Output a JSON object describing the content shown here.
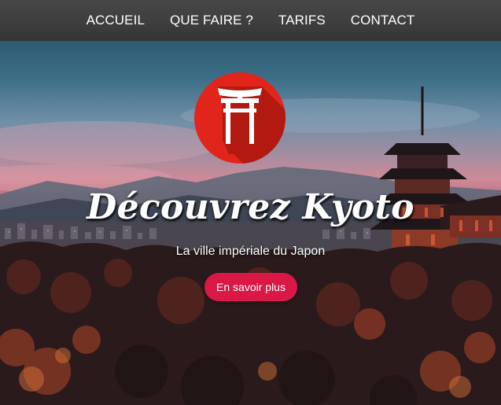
{
  "nav": {
    "items": [
      {
        "label": "ACCUEIL"
      },
      {
        "label": "QUE FAIRE ?"
      },
      {
        "label": "TARIFS"
      },
      {
        "label": "CONTACT"
      }
    ]
  },
  "hero": {
    "logo_icon": "torii-gate-icon",
    "title": "Découvrez Kyoto",
    "subtitle": "La ville impériale du Japon",
    "cta_label": "En savoir plus",
    "background_image": "kyoto-sunset-pagoda-skyline"
  },
  "colors": {
    "nav_bg": "#3e3e3e",
    "logo_circle": "#e1251b",
    "logo_shadow": "#a8170f",
    "cta_bg": "#d91845",
    "text": "#ffffff"
  }
}
